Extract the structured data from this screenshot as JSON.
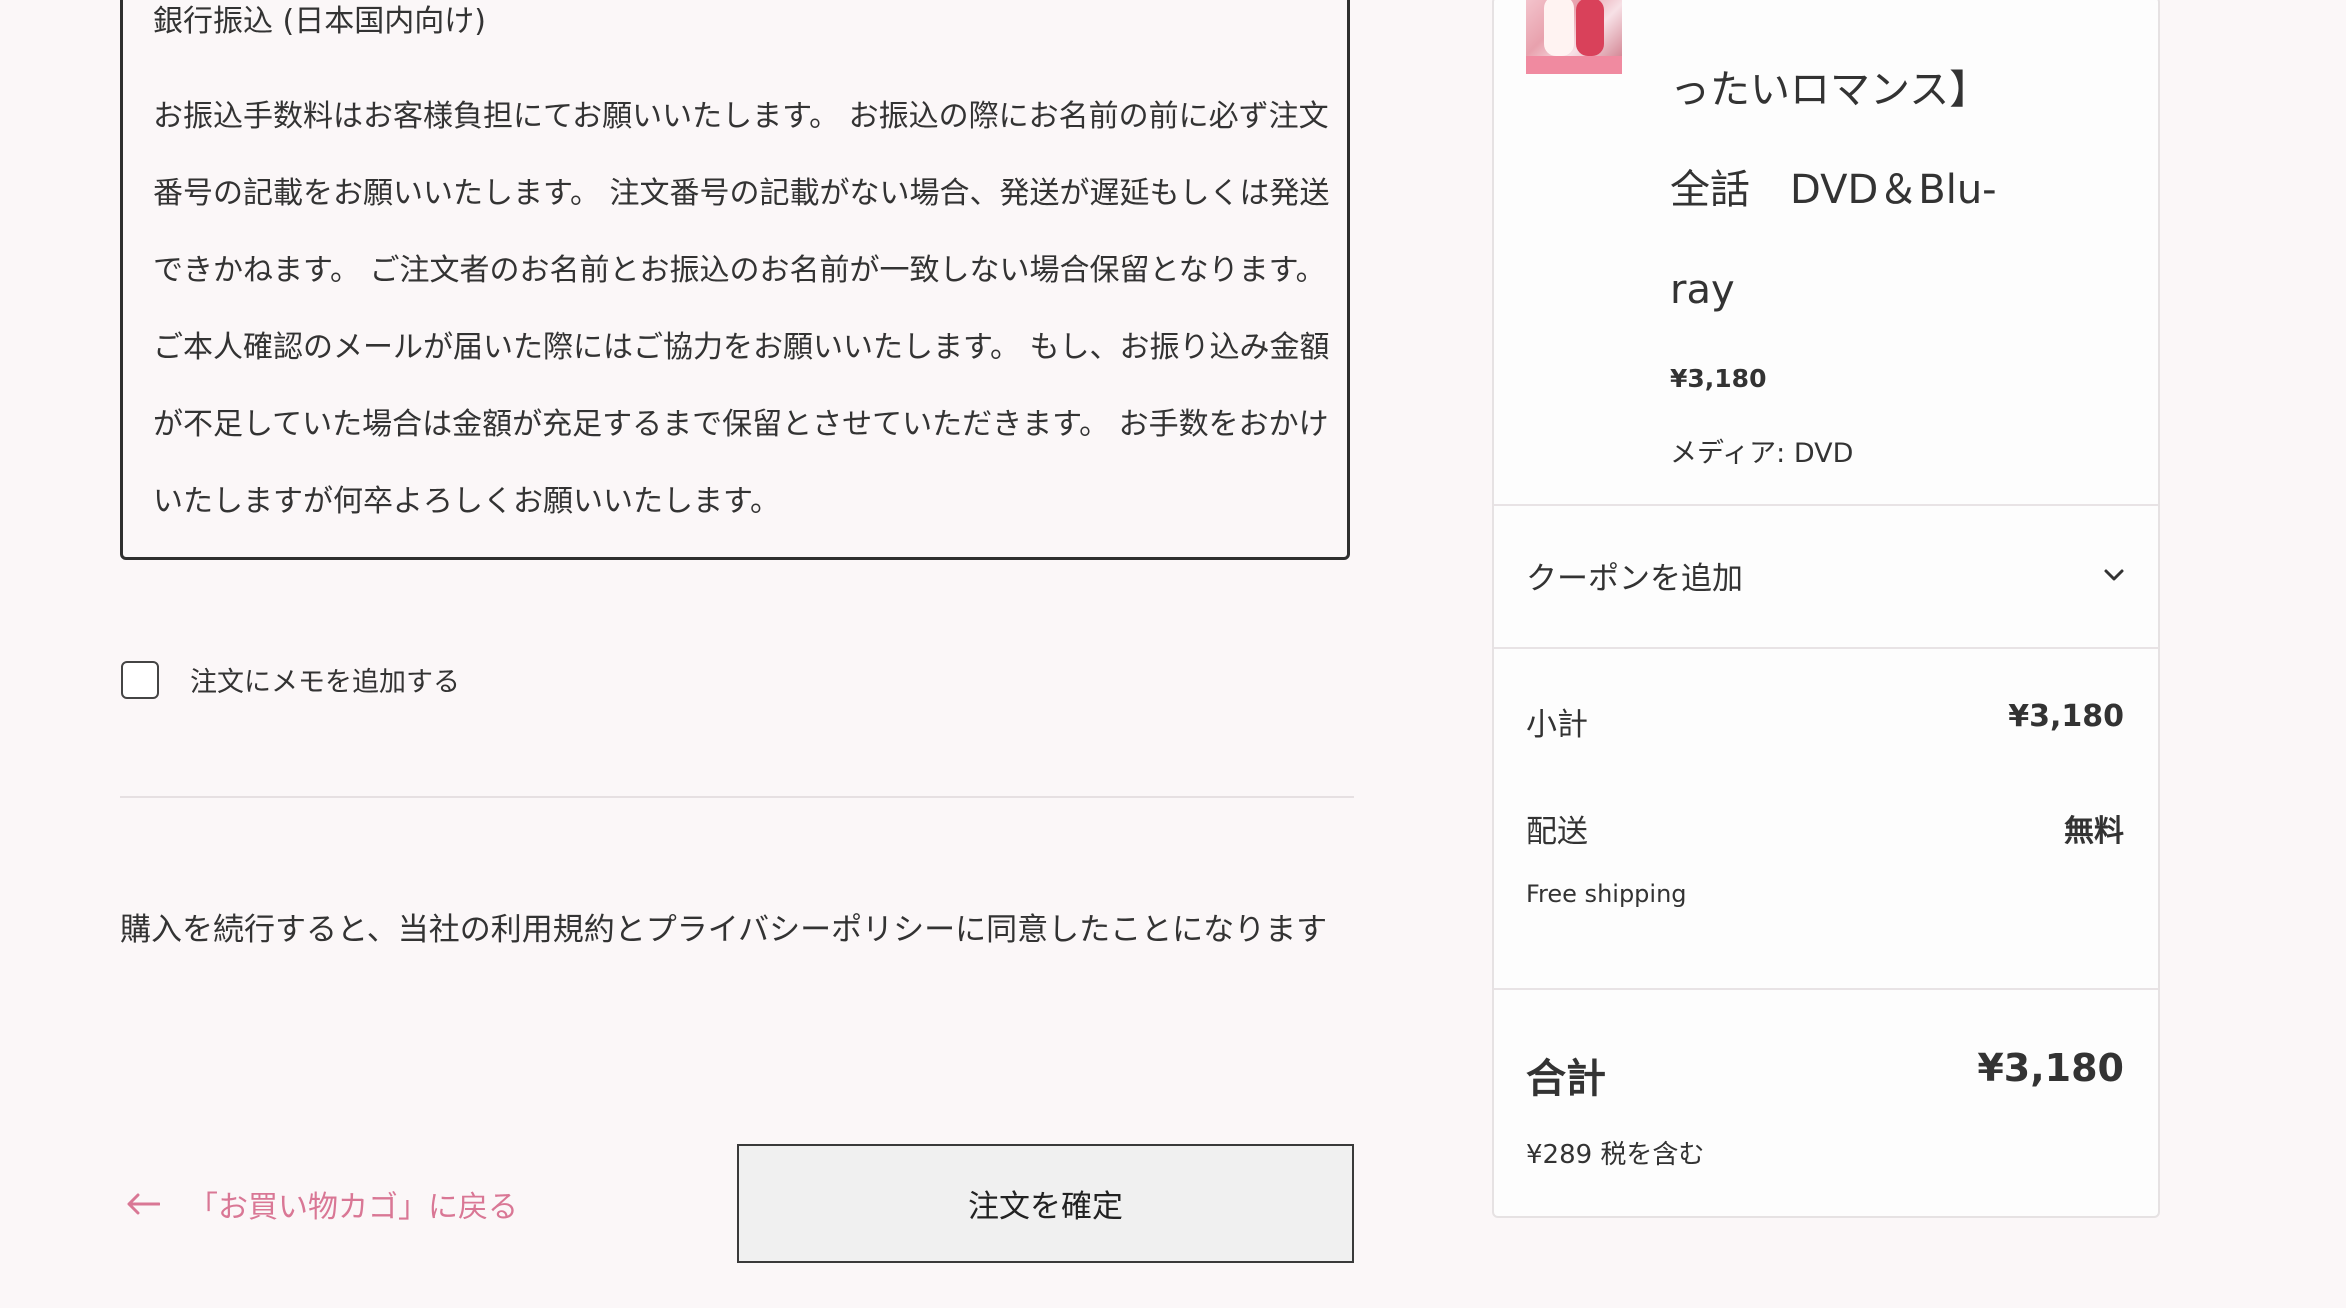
{
  "payment": {
    "title": "銀行振込 (日本国内向け)",
    "description": "お振込手数料はお客様負担にてお願いいたします。 お振込の際にお名前の前に必ず注文番号の記載をお願いいたします。 注文番号の記載がない場合、発送が遅延もしくは発送できかねます。 ご注文者のお名前とお振込のお名前が一致しない場合保留となります。 ご本人確認のメールが届いた際にはご協力をお願いいたします。 もし、お振り込み金額が不足していた場合は金額が充足するまで保留とさせていただきます。 お手数をおかけいたしますが何卒よろしくお願いいたします。"
  },
  "memo": {
    "label": "注文にメモを追加する",
    "checked": false
  },
  "terms": {
    "text": "購入を続行すると、当社の利用規約とプライバシーポリシーに同意したことになります"
  },
  "actions": {
    "back_label": "「お買い物カゴ」に戻る",
    "confirm_label": "注文を確定"
  },
  "summary": {
    "product": {
      "title_lines": [
        "ったいロマンス】",
        "全話　DVD＆Blu-",
        "ray"
      ],
      "price": "¥3,180",
      "media_label": "メディア:",
      "media_value": "DVD"
    },
    "coupon_label": "クーポンを追加",
    "subtotal_label": "小計",
    "subtotal_value": "¥3,180",
    "shipping_label": "配送",
    "shipping_value": "無料",
    "shipping_method": "Free shipping",
    "total_label": "合計",
    "total_value": "¥3,180",
    "tax_note": "¥289 税を含む"
  },
  "colors": {
    "background": "#fbf7f8",
    "link_accent": "#d97795",
    "button_bg": "#f0f0f0"
  }
}
